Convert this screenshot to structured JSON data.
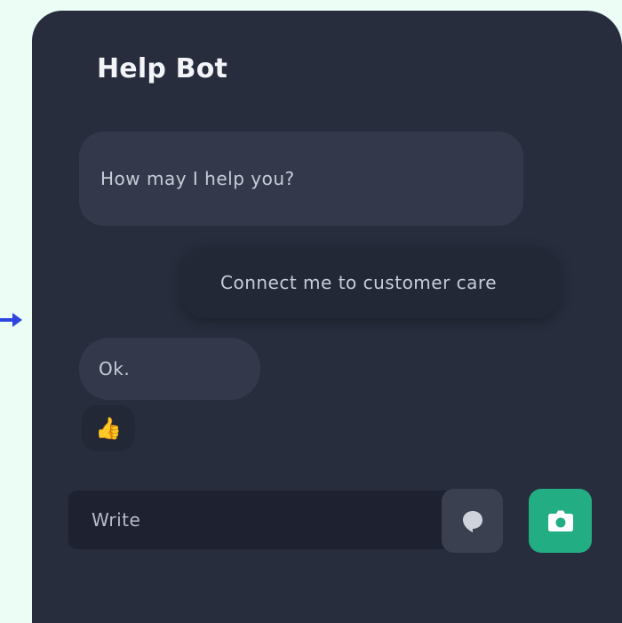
{
  "app": {
    "title": "Help Bot"
  },
  "messages": [
    {
      "sender": "bot",
      "text": "How may I help you?"
    },
    {
      "sender": "user",
      "text": "Connect me to customer care"
    },
    {
      "sender": "bot",
      "text": "Ok."
    }
  ],
  "reaction": {
    "emoji": "👍",
    "icon": "thumbs-up-icon"
  },
  "composer": {
    "placeholder": "Write",
    "value": "",
    "chat_icon": "speech-bubble-icon",
    "camera_icon": "camera-icon"
  },
  "colors": {
    "page_background": "#ecfdf6",
    "panel_background": "#272d3d",
    "bot_bubble": "#33394a",
    "user_bubble": "#232837",
    "accent": "#22ae82",
    "pointer_arrow": "#2f45e0"
  }
}
